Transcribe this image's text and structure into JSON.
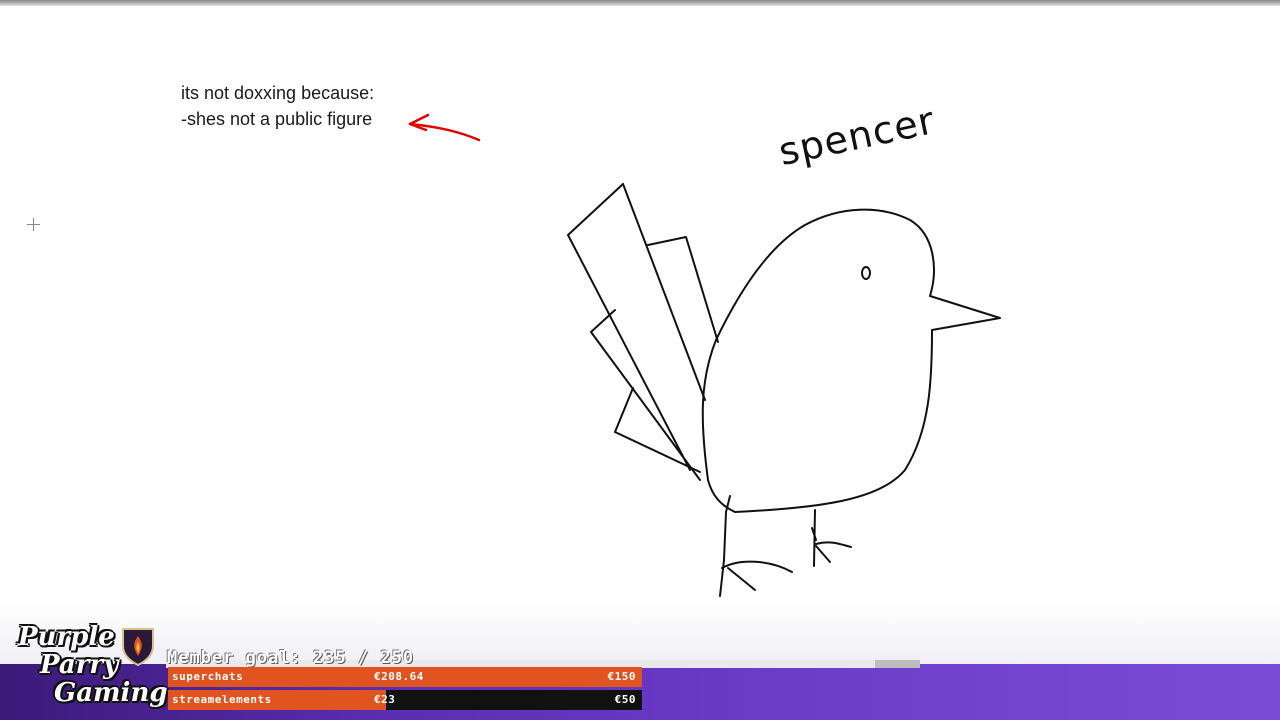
{
  "canvas": {
    "note_line1": "its not doxxing because:",
    "note_line2": "-shes not a public figure",
    "handwritten_label": "spencer",
    "arrow_color": "#e00000",
    "drawing_subject": "bird-sketch-icon"
  },
  "overlay": {
    "logo": {
      "word1": "Purple",
      "word2": "Parry",
      "word3": "Gaming"
    },
    "member_goal": {
      "text": "Member goal: 235 / 250",
      "current": 235,
      "target": 250
    },
    "bars": [
      {
        "label": "superchats",
        "current_text": "€208.64",
        "goal_text": "€150",
        "current": 208.64,
        "goal": 150,
        "fill_color": "#e2541f"
      },
      {
        "label": "streamelements",
        "current_text": "€23",
        "goal_text": "€50",
        "current": 23,
        "goal": 50,
        "fill_color": "#e2541f"
      }
    ],
    "band_color": "#5a2db2"
  }
}
